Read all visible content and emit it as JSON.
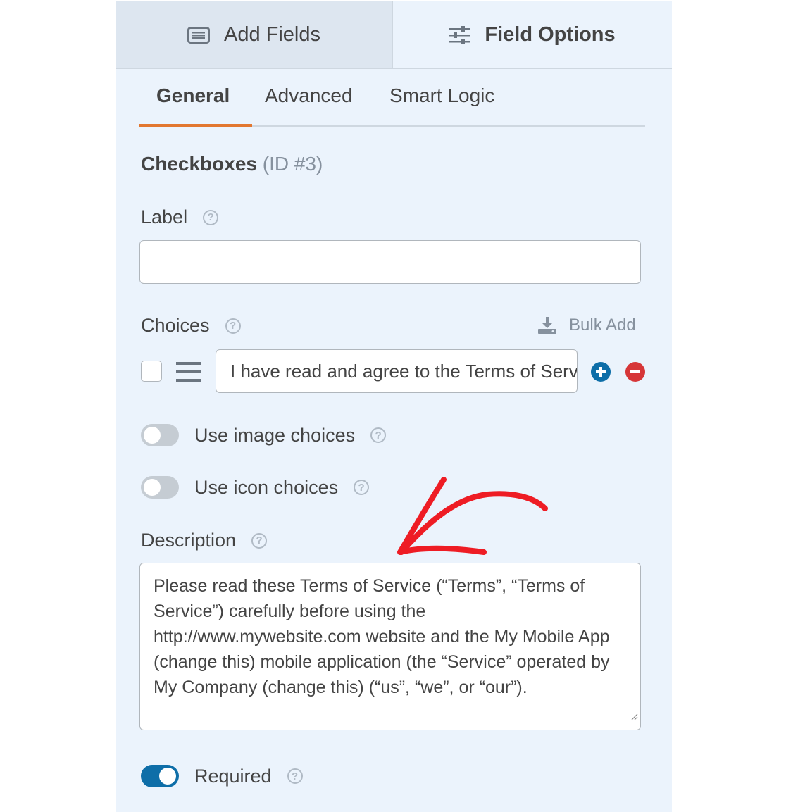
{
  "top_tabs": {
    "add_fields": "Add Fields",
    "field_options": "Field Options"
  },
  "sub_tabs": {
    "general": "General",
    "advanced": "Advanced",
    "smart_logic": "Smart Logic"
  },
  "field": {
    "name": "Checkboxes",
    "id": "(ID #3)"
  },
  "label_field": {
    "label": "Label",
    "value": ""
  },
  "choices": {
    "label": "Choices",
    "bulk_add": "Bulk Add",
    "items": [
      {
        "text": "I have read and agree to the Terms of Service",
        "checked": false
      }
    ]
  },
  "toggles": {
    "image_choices": {
      "label": "Use image choices",
      "on": false
    },
    "icon_choices": {
      "label": "Use icon choices",
      "on": false
    },
    "required": {
      "label": "Required",
      "on": true
    }
  },
  "description": {
    "label": "Description",
    "value": "Please read these Terms of Service (“Terms”, “Terms of Service”) carefully before using the http://www.mywebsite.com website and the My Mobile App (change this) mobile application (the “Service” operated by My Company (change this) (“us”, “we”, or “our”)."
  },
  "colors": {
    "accent_orange": "#e27730",
    "toggle_on": "#0e6ea8",
    "add_blue": "#0e6ea8",
    "remove_red": "#d63638",
    "annotation_arrow": "#ee1c24"
  }
}
